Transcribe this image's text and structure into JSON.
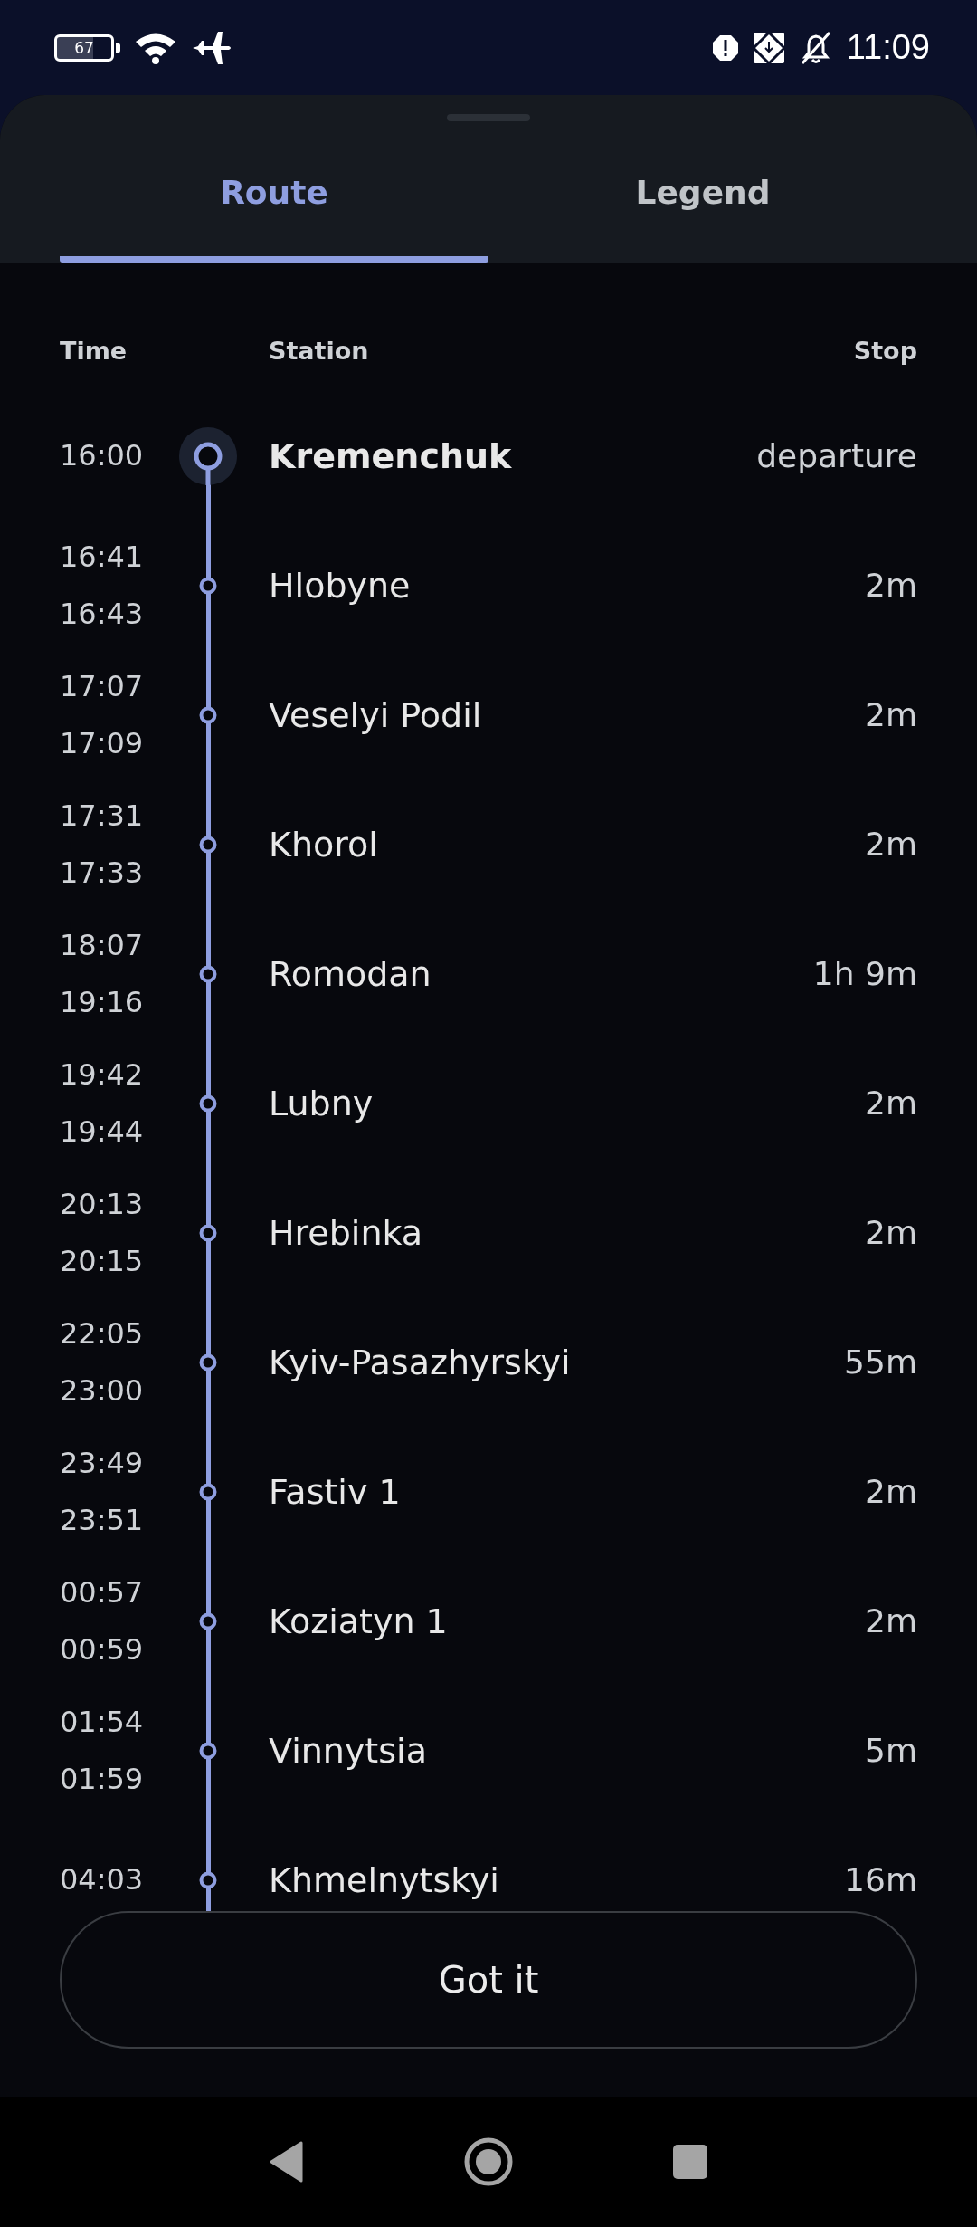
{
  "status_bar": {
    "battery": "67",
    "time": "11:09"
  },
  "tabs": [
    {
      "label": "Route",
      "selected": true
    },
    {
      "label": "Legend",
      "selected": false
    }
  ],
  "columns": {
    "time": "Time",
    "station": "Station",
    "stop": "Stop"
  },
  "stations": [
    {
      "kind": "origin",
      "times": [
        "16:00"
      ],
      "name": "Kremenchuk",
      "stop": "departure"
    },
    {
      "kind": "stop",
      "times": [
        "16:41",
        "16:43"
      ],
      "name": "Hlobyne",
      "stop": "2m"
    },
    {
      "kind": "stop",
      "times": [
        "17:07",
        "17:09"
      ],
      "name": "Veselyi Podil",
      "stop": "2m"
    },
    {
      "kind": "stop",
      "times": [
        "17:31",
        "17:33"
      ],
      "name": "Khorol",
      "stop": "2m"
    },
    {
      "kind": "stop",
      "times": [
        "18:07",
        "19:16"
      ],
      "name": "Romodan",
      "stop": "1h 9m"
    },
    {
      "kind": "stop",
      "times": [
        "19:42",
        "19:44"
      ],
      "name": "Lubny",
      "stop": "2m"
    },
    {
      "kind": "stop",
      "times": [
        "20:13",
        "20:15"
      ],
      "name": "Hrebinka",
      "stop": "2m"
    },
    {
      "kind": "stop",
      "times": [
        "22:05",
        "23:00"
      ],
      "name": "Kyiv-Pasazhyrskyi",
      "stop": "55m"
    },
    {
      "kind": "stop",
      "times": [
        "23:49",
        "23:51"
      ],
      "name": "Fastiv 1",
      "stop": "2m"
    },
    {
      "kind": "stop",
      "times": [
        "00:57",
        "00:59"
      ],
      "name": "Koziatyn 1",
      "stop": "2m"
    },
    {
      "kind": "stop",
      "times": [
        "01:54",
        "01:59"
      ],
      "name": "Vinnytsia",
      "stop": "5m"
    },
    {
      "kind": "stop",
      "times": [
        "04:03"
      ],
      "name": "Khmelnytskyi",
      "stop": "16m"
    }
  ],
  "button": "Got it"
}
